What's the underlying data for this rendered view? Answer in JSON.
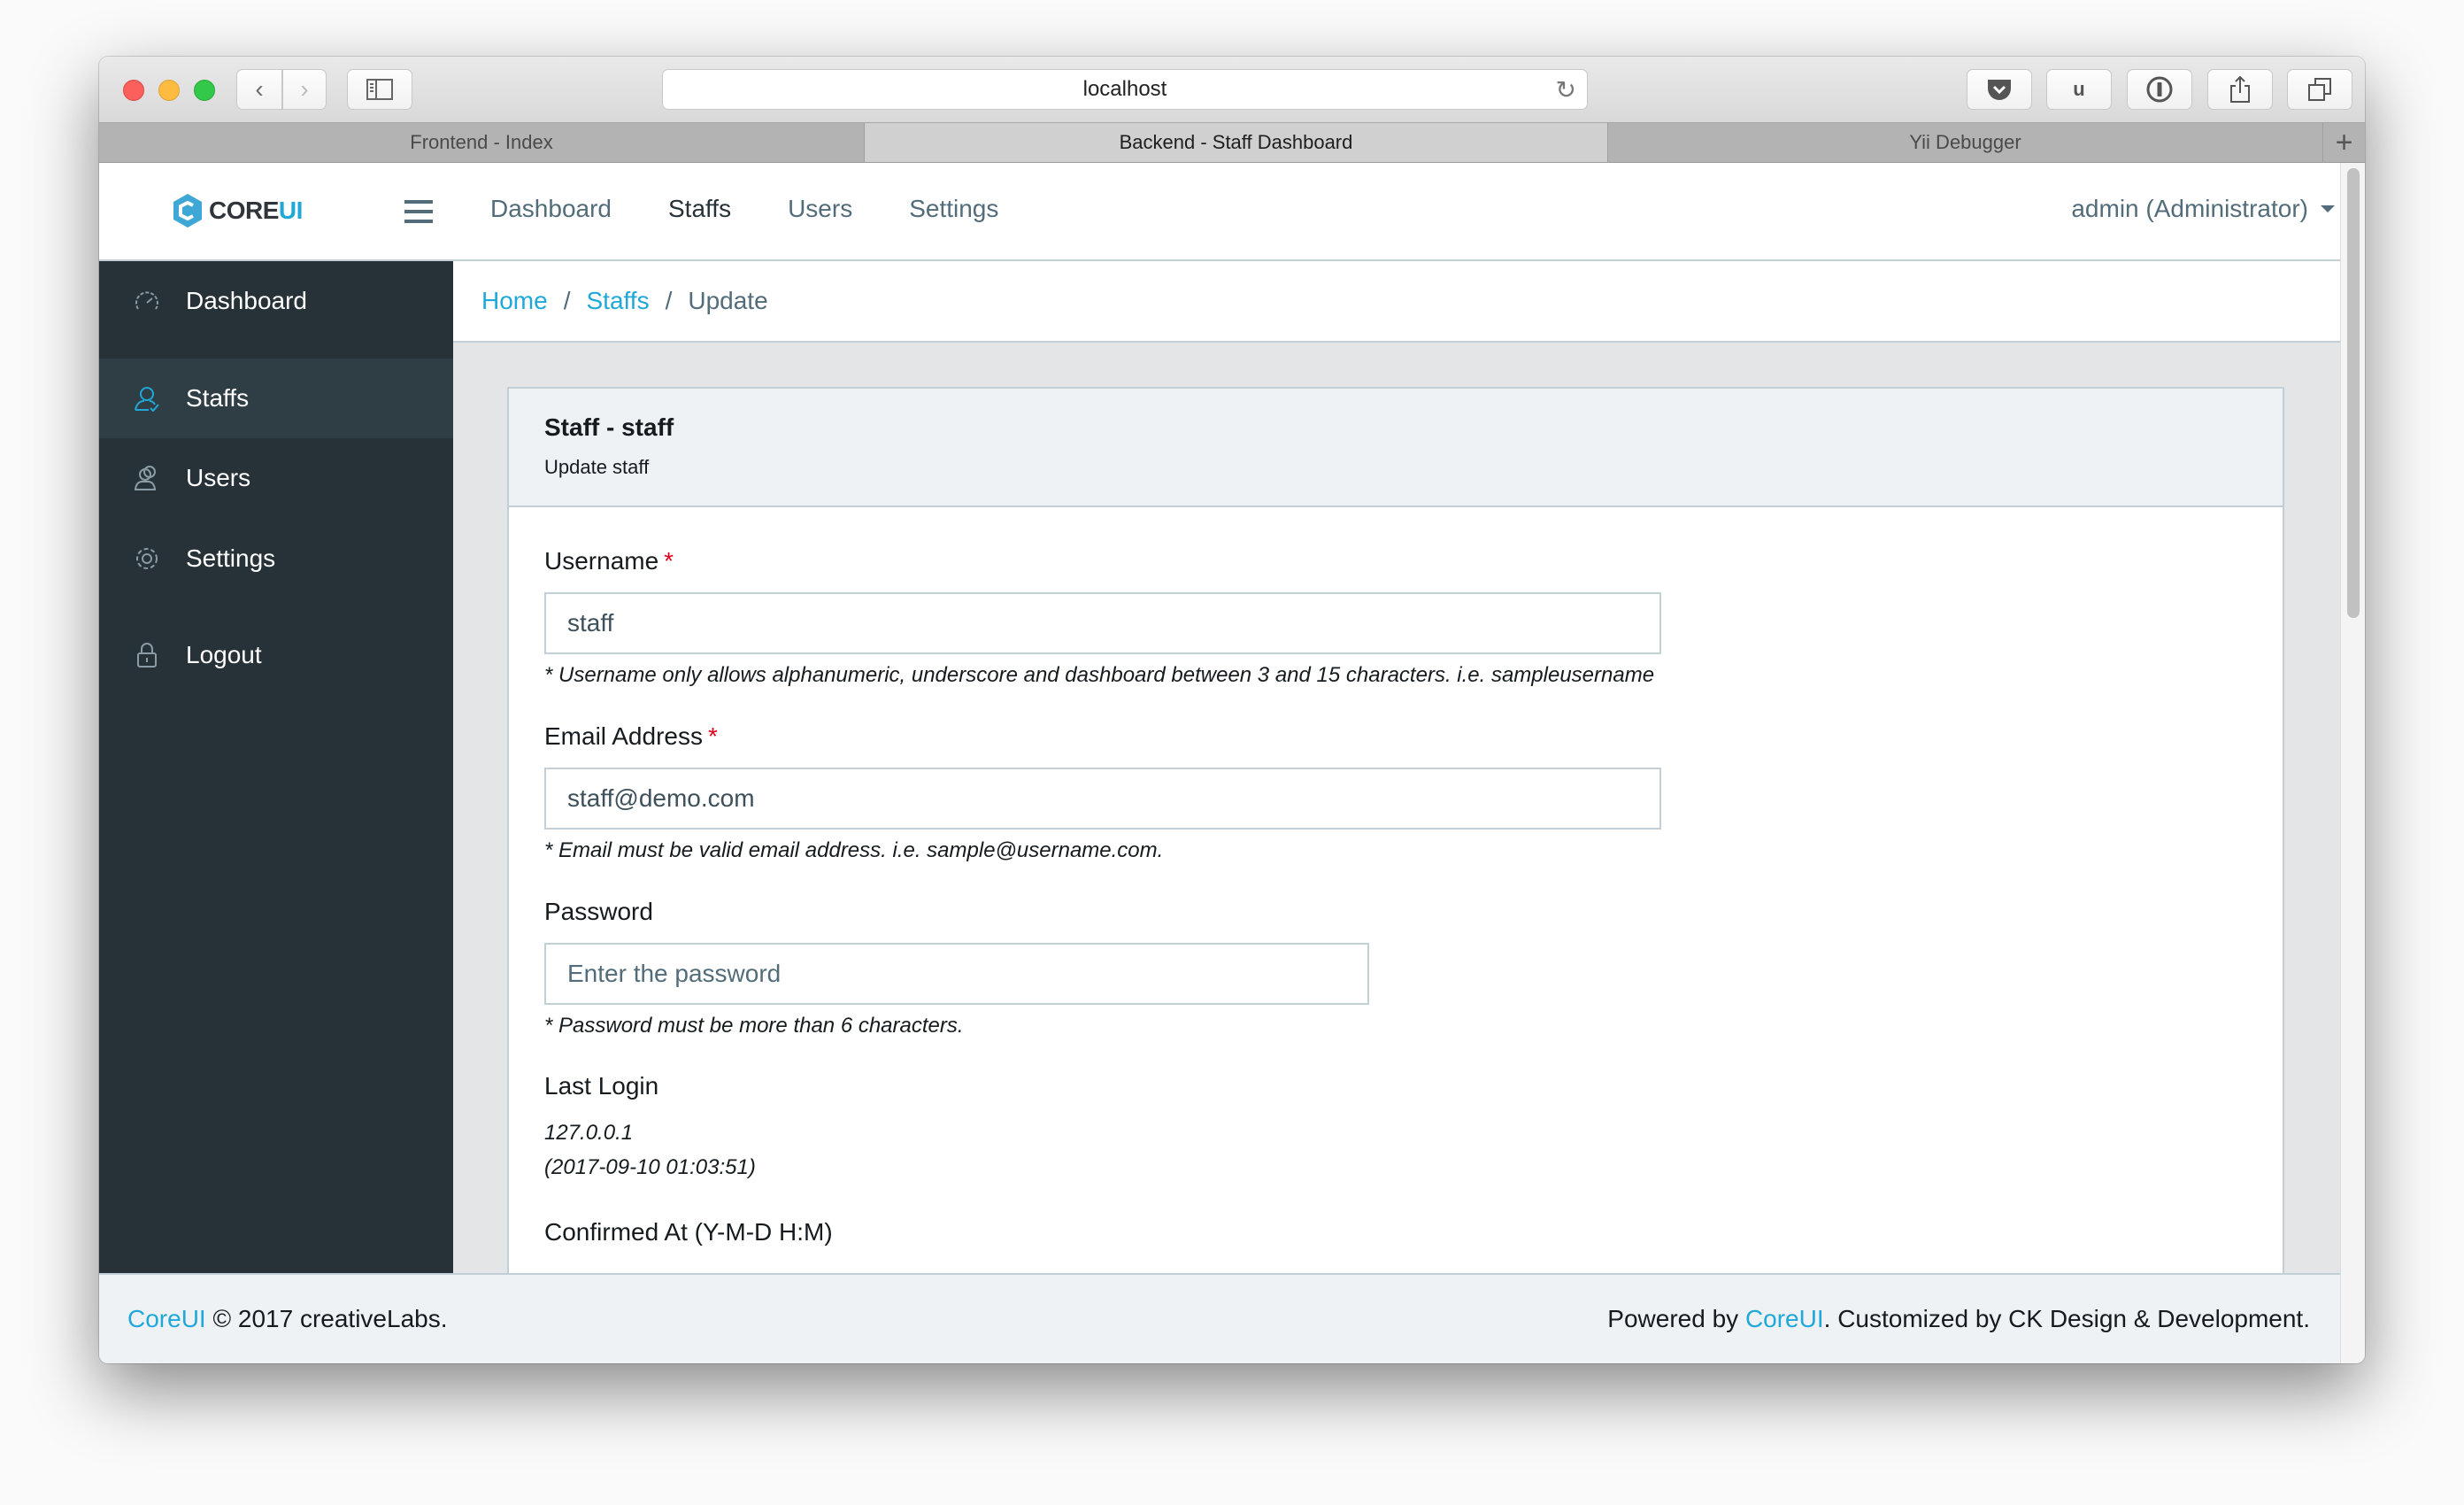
{
  "browser": {
    "url": "localhost",
    "tabs": [
      {
        "label": "Frontend - Index",
        "active": false
      },
      {
        "label": "Backend - Staff Dashboard",
        "active": true
      },
      {
        "label": "Yii Debugger",
        "active": false
      }
    ],
    "extensions": [
      "pocket-icon",
      "ublock-icon",
      "1password-icon",
      "share-icon",
      "tabs-overview-icon"
    ],
    "ublock_label": "u",
    "new_tab_label": "+"
  },
  "header": {
    "brand_core": "CORE",
    "brand_ui": "UI",
    "nav": [
      {
        "label": "Dashboard",
        "active": false
      },
      {
        "label": "Staffs",
        "active": true
      },
      {
        "label": "Users",
        "active": false
      },
      {
        "label": "Settings",
        "active": false
      }
    ],
    "user": "admin (Administrator)"
  },
  "sidebar": {
    "items": [
      {
        "label": "Dashboard",
        "icon": "speedometer-icon",
        "active": false
      },
      {
        "label": "Staffs",
        "icon": "user-check-icon",
        "active": true
      },
      {
        "label": "Users",
        "icon": "users-icon",
        "active": false
      },
      {
        "label": "Settings",
        "icon": "gear-icon",
        "active": false
      },
      {
        "label": "Logout",
        "icon": "lock-icon",
        "active": false
      }
    ]
  },
  "breadcrumb": {
    "items": [
      "Home",
      "Staffs"
    ],
    "current": "Update",
    "separator": "/"
  },
  "card": {
    "title": "Staff - staff",
    "subtitle": "Update staff"
  },
  "form": {
    "username": {
      "label": "Username",
      "required_mark": "*",
      "value": "staff",
      "help": "* Username only allows alphanumeric, underscore and dashboard between 3 and 15 characters. i.e. sampleusername"
    },
    "email": {
      "label": "Email Address",
      "required_mark": "*",
      "value": "staff@demo.com",
      "help": "* Email must be valid email address. i.e. sample@username.com."
    },
    "password": {
      "label": "Password",
      "value": "",
      "placeholder": "Enter the password",
      "help": "* Password must be more than 6 characters."
    },
    "last_login": {
      "label": "Last Login",
      "ip": "127.0.0.1",
      "time": "(2017-09-10 01:03:51)"
    },
    "confirmed_at": {
      "label": "Confirmed At (Y-M-D H:M)"
    }
  },
  "footer": {
    "left_link": "CoreUI",
    "left_text": " © 2017 creativeLabs.",
    "right_prefix": "Powered by ",
    "right_link": "CoreUI",
    "right_suffix": ". Customized by CK Design & Development."
  },
  "colors": {
    "accent": "#20a8d8",
    "sidebar_bg": "#263238",
    "sidebar_active_bg": "#2f3d45",
    "required": "#e3001b"
  }
}
